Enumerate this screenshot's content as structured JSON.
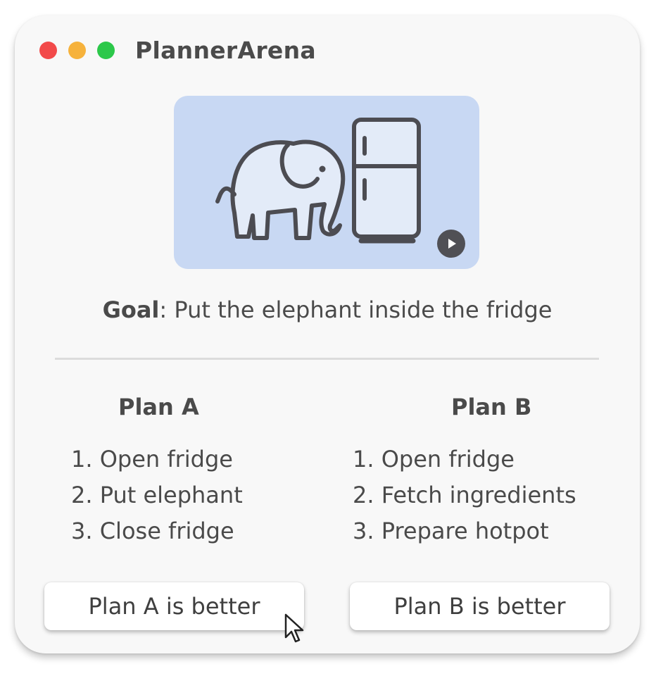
{
  "window": {
    "title": "PlannerArena",
    "controls": [
      "close",
      "minimize",
      "zoom"
    ]
  },
  "media": {
    "illustration_icons": [
      "elephant-icon",
      "fridge-icon"
    ],
    "play_icon": "play-icon",
    "background_color": "#c8d8f3"
  },
  "goal": {
    "label": "Goal",
    "separator": ":",
    "text": " Put the elephant inside the fridge"
  },
  "plans": [
    {
      "title": "Plan A",
      "steps": [
        "1. Open fridge",
        "2. Put elephant",
        "3. Close fridge"
      ],
      "vote_label": "Plan A is better"
    },
    {
      "title": "Plan B",
      "steps": [
        "1. Open fridge",
        "2. Fetch ingredients",
        "3. Prepare hotpot"
      ],
      "vote_label": "Plan B is better"
    }
  ],
  "colors": {
    "close": "#f24a4a",
    "minimize": "#f6b23c",
    "zoom": "#2cc84a",
    "text": "#4a4a4a"
  }
}
